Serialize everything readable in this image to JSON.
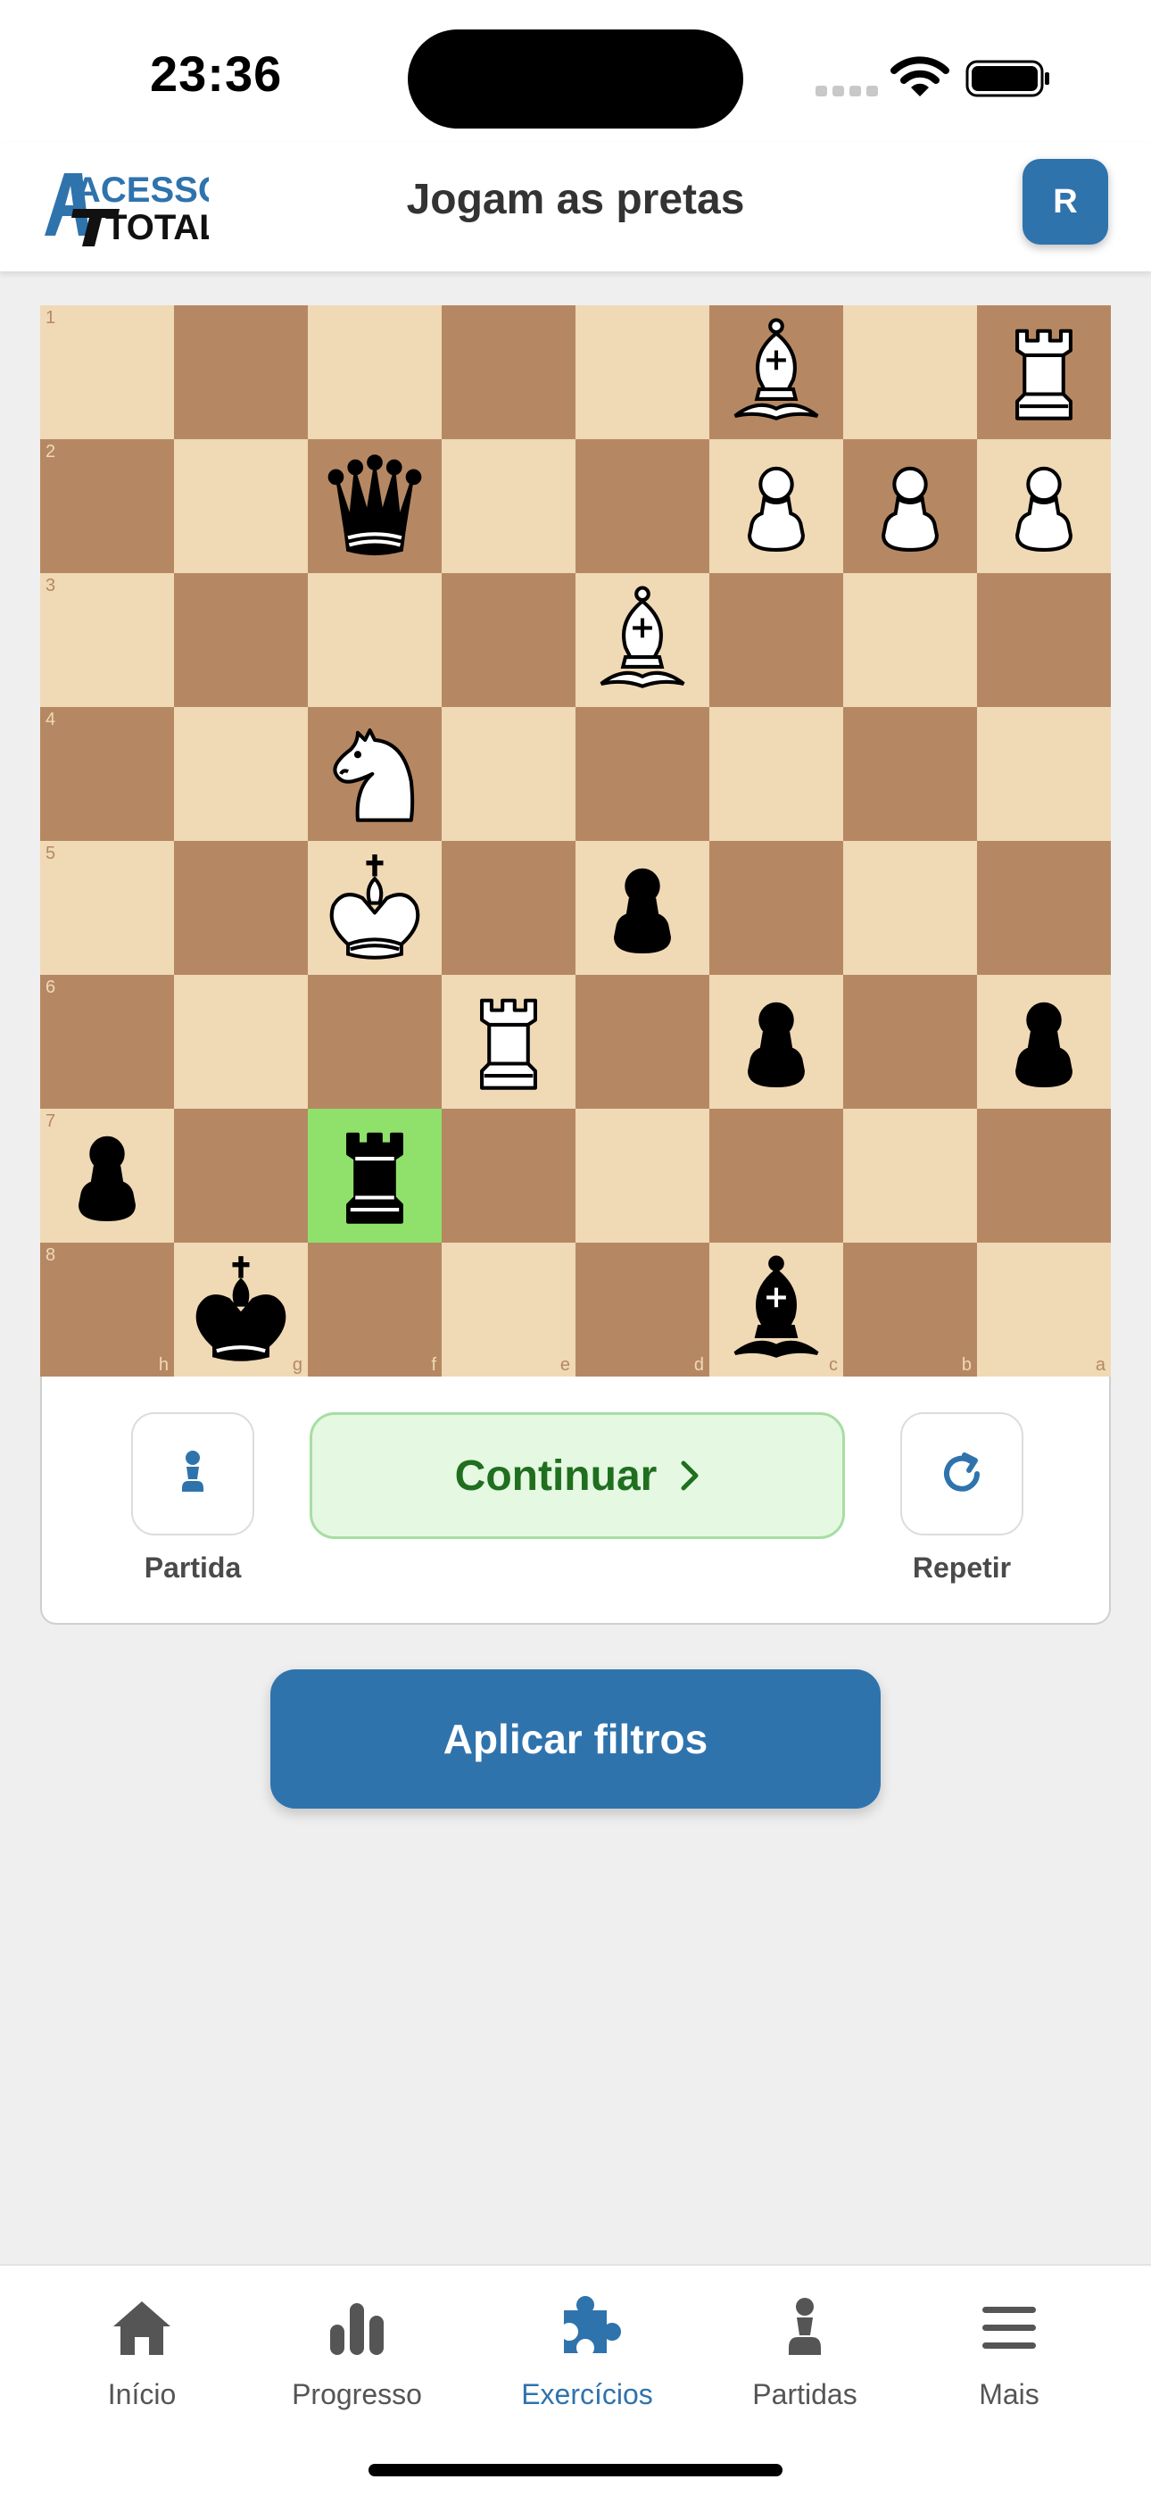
{
  "status_bar": {
    "time": "23:36"
  },
  "header": {
    "logo_text_line1": "ACESSO",
    "logo_text_line2": "TOTAL",
    "title": "Jogam as pretas",
    "avatar_initial": "R"
  },
  "board": {
    "orientation": "black-bottom",
    "ranks_top_to_bottom": [
      "1",
      "2",
      "3",
      "4",
      "5",
      "6",
      "7",
      "8"
    ],
    "files_left_to_right": [
      "h",
      "g",
      "f",
      "e",
      "d",
      "c",
      "b",
      "a"
    ],
    "highlighted_squares": [
      "f7"
    ],
    "pieces": [
      {
        "square": "c1",
        "piece": "white-bishop"
      },
      {
        "square": "a1",
        "piece": "white-rook"
      },
      {
        "square": "f2",
        "piece": "black-queen"
      },
      {
        "square": "c2",
        "piece": "white-pawn"
      },
      {
        "square": "b2",
        "piece": "white-pawn"
      },
      {
        "square": "a2",
        "piece": "white-pawn"
      },
      {
        "square": "d3",
        "piece": "white-bishop"
      },
      {
        "square": "f4",
        "piece": "white-knight"
      },
      {
        "square": "f5",
        "piece": "white-king"
      },
      {
        "square": "d5",
        "piece": "black-pawn"
      },
      {
        "square": "e6",
        "piece": "white-rook"
      },
      {
        "square": "c6",
        "piece": "black-pawn"
      },
      {
        "square": "a6",
        "piece": "black-pawn"
      },
      {
        "square": "h7",
        "piece": "black-pawn"
      },
      {
        "square": "f7",
        "piece": "black-rook"
      },
      {
        "square": "g8",
        "piece": "black-king"
      },
      {
        "square": "c8",
        "piece": "black-bishop"
      }
    ]
  },
  "controls": {
    "game_label": "Partida",
    "continue_label": "Continuar",
    "repeat_label": "Repetir"
  },
  "filters": {
    "apply_label": "Aplicar filtros"
  },
  "tab_bar": {
    "active": "Exercícios",
    "items": [
      {
        "label": "Início",
        "icon": "home-icon"
      },
      {
        "label": "Progresso",
        "icon": "bar-chart-icon"
      },
      {
        "label": "Exercícios",
        "icon": "puzzle-icon"
      },
      {
        "label": "Partidas",
        "icon": "pawn-icon"
      },
      {
        "label": "Mais",
        "icon": "menu-icon"
      }
    ]
  },
  "colors": {
    "accent": "#2f73ad",
    "board_light": "#f0d9b5",
    "board_dark": "#b58863",
    "highlight": "#8fe16b",
    "continue_bg": "#e5f8e2",
    "continue_text": "#1f6f1f"
  }
}
